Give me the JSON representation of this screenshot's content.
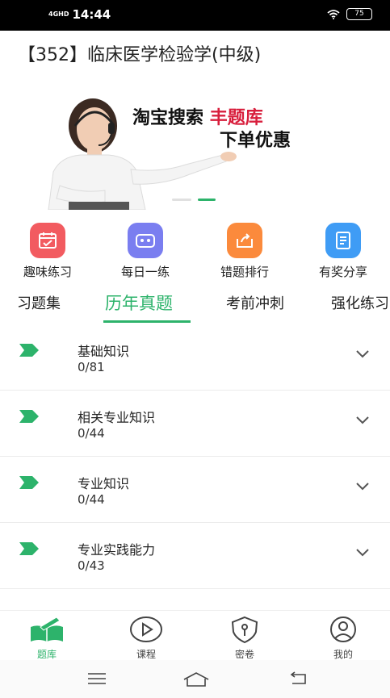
{
  "status_bar": {
    "network": "4GHD",
    "time": "14:44",
    "battery": "75"
  },
  "header": {
    "title": "【352】临床医学检验学(中级)"
  },
  "banner": {
    "text_line1_prefix": "淘宝搜索",
    "text_line1_highlight": "丰题库",
    "text_line2": "下单优惠",
    "highlight_color": "#d81e3c"
  },
  "quick_actions": [
    {
      "label": "趣味练习",
      "icon": "calendar-check-icon",
      "color": "#f25b60"
    },
    {
      "label": "每日一练",
      "icon": "robot-face-icon",
      "color": "#7a7ef0"
    },
    {
      "label": "错题排行",
      "icon": "share-box-icon",
      "color": "#fb8a3c"
    },
    {
      "label": "有奖分享",
      "icon": "book-icon",
      "color": "#3f9cf5"
    }
  ],
  "tabs": [
    {
      "label": "习题集"
    },
    {
      "label": "历年真题",
      "active": true
    },
    {
      "label": "考前冲刺"
    },
    {
      "label": "强化练习"
    }
  ],
  "accent_color": "#2db36b",
  "list": [
    {
      "title": "基础知识",
      "progress": "0/81"
    },
    {
      "title": "相关专业知识",
      "progress": "0/44"
    },
    {
      "title": "专业知识",
      "progress": "0/44"
    },
    {
      "title": "专业实践能力",
      "progress": "0/43"
    }
  ],
  "bottom_nav": [
    {
      "label": "题库",
      "icon": "book-pen-icon",
      "active": true
    },
    {
      "label": "课程",
      "icon": "play-circle-icon"
    },
    {
      "label": "密卷",
      "icon": "shield-key-icon"
    },
    {
      "label": "我的",
      "icon": "user-circle-icon"
    }
  ],
  "system_nav": {
    "icons": [
      "menu-icon",
      "home-icon",
      "back-icon"
    ]
  }
}
